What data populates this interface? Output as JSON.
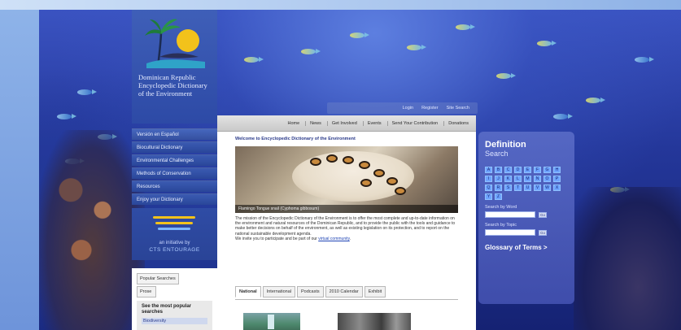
{
  "site": {
    "logo_title": "Dominican Republic Encyclopedic Dictionary of the Environment"
  },
  "left_nav": {
    "items": [
      {
        "label": "Versión en Español"
      },
      {
        "label": "Biocultural Dictionary"
      },
      {
        "label": "Environmental Challenges"
      },
      {
        "label": "Methods of Conservation"
      },
      {
        "label": "Resources"
      },
      {
        "label": "Enjoy your Dictionary"
      }
    ],
    "sponsor_line1": "an initiative by",
    "sponsor_line2": "CTS ENTOURAGE"
  },
  "utility_nav": {
    "items": [
      "Login",
      "Register",
      "Site Search"
    ]
  },
  "top_nav": {
    "items": [
      "Home",
      "News",
      "Get Involved",
      "Events",
      "Send Your Contribution",
      "Donations"
    ]
  },
  "main": {
    "welcome": "Welcome to Encyclopedic Dictionary of the Environment",
    "hero_caption": "Flamingo Tongue snail (Cyphoma gibbosum)",
    "intro": "The mission of the Encyclopedic Dictionary of the Environment is to offer the most complete and up-to-date information on the environment and natural resources of the Dominican Republic, and to provide the public with the tools and guidance to make better decisions on behalf of the environment, as well as existing legislation on its protection, and to report on the national sustainable development agenda.",
    "intro_cta_prefix": "We invite you to participate and be part of our",
    "intro_cta_link": "virtual community",
    "tabs": [
      "National",
      "International",
      "Podcasts",
      "2010 Calendar",
      "Exhibit"
    ]
  },
  "side": {
    "tab1": "Popular Searches",
    "tab2": "Prose",
    "panel_title": "See the most popular searches",
    "panel_item": "Biodiversity"
  },
  "definition": {
    "title": "Definition",
    "subtitle": "Search",
    "letters": [
      "A",
      "B",
      "C",
      "D",
      "E",
      "F",
      "G",
      "H",
      "I",
      "J",
      "K",
      "L",
      "M",
      "N",
      "O",
      "P",
      "Q",
      "R",
      "S",
      "T",
      "U",
      "V",
      "W",
      "X",
      "Y",
      "Z"
    ],
    "search_word_label": "Search by Word",
    "search_topic_label": "Search by Topic",
    "go_label": "Go",
    "glossary": "Glossary of Terms >"
  }
}
